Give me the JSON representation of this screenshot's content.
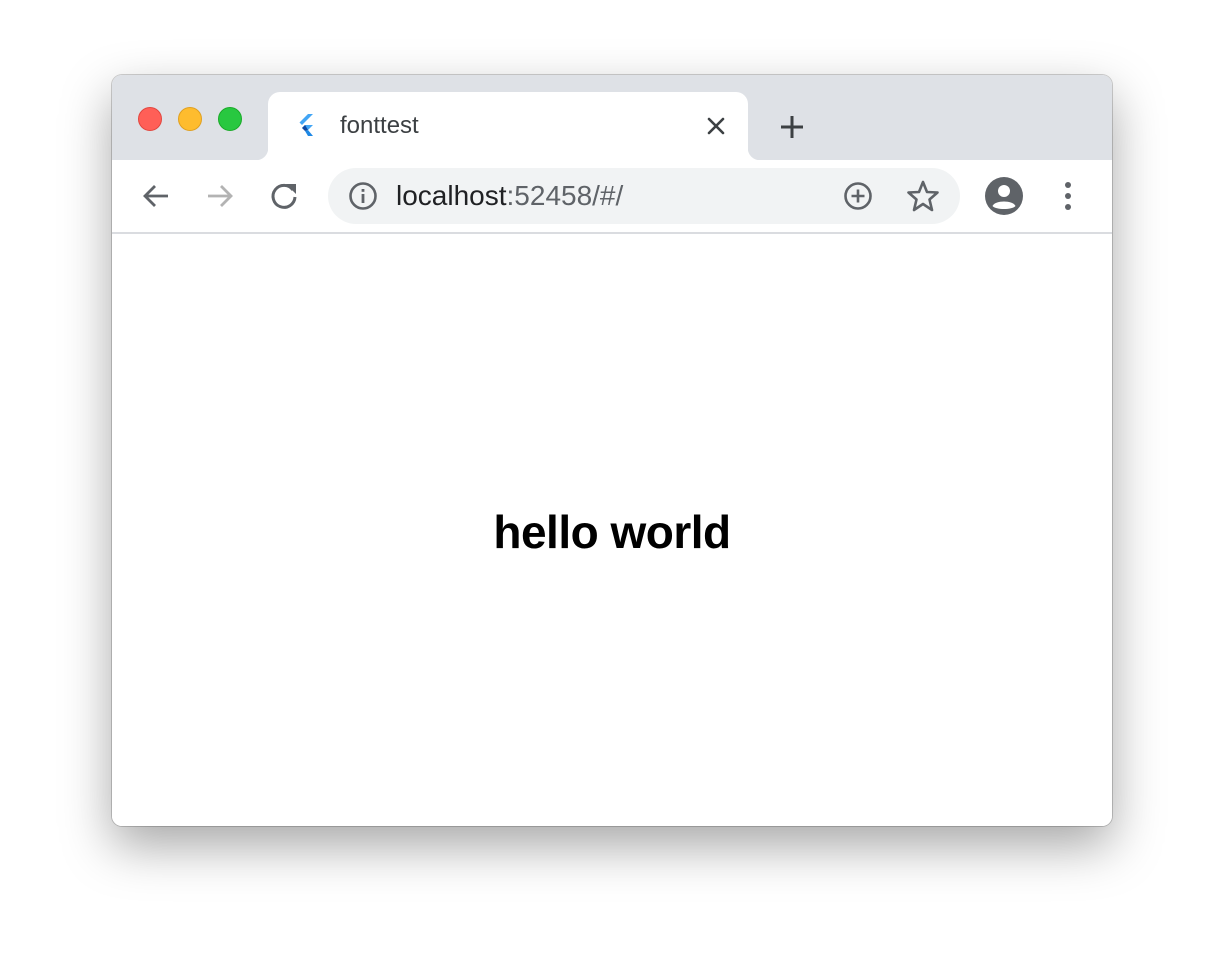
{
  "window": {
    "traffic_lights": {
      "close_color": "#ff5f57",
      "minimize_color": "#febc2e",
      "maximize_color": "#28c840"
    }
  },
  "tab": {
    "title": "fonttest",
    "favicon": "flutter-icon",
    "close_icon": "close-icon"
  },
  "new_tab_icon": "plus-icon",
  "toolbar": {
    "back_icon": "arrow-left-icon",
    "forward_icon": "arrow-right-icon",
    "reload_icon": "reload-icon",
    "profile_icon": "account-circle-icon",
    "menu_icon": "more-vert-icon"
  },
  "omnibox": {
    "info_icon": "info-icon",
    "host": "localhost",
    "path": ":52458/#/",
    "install_icon": "add-circle-icon",
    "bookmark_icon": "star-icon"
  },
  "page": {
    "text": "hello world"
  }
}
